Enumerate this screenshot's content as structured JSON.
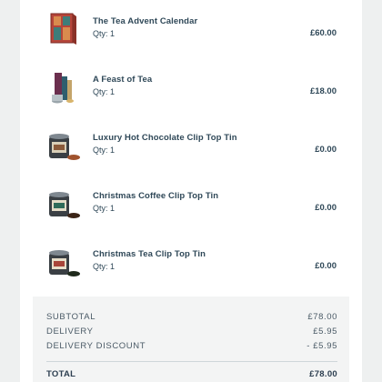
{
  "items": [
    {
      "name": "The Tea Advent Calendar",
      "qty": "Qty: 1",
      "price": "£60.00",
      "icon": "advent-calendar-icon"
    },
    {
      "name": "A Feast of Tea",
      "qty": "Qty: 1",
      "price": "£18.00",
      "icon": "tea-gift-set-icon"
    },
    {
      "name": "Luxury Hot Chocolate Clip Top Tin",
      "qty": "Qty: 1",
      "price": "£0.00",
      "icon": "hot-chocolate-tin-icon"
    },
    {
      "name": "Christmas Coffee Clip Top Tin",
      "qty": "Qty: 1",
      "price": "£0.00",
      "icon": "coffee-tin-icon"
    },
    {
      "name": "Christmas Tea Clip Top Tin",
      "qty": "Qty: 1",
      "price": "£0.00",
      "icon": "tea-tin-icon"
    }
  ],
  "summary": {
    "subtotal_label": "SUBTOTAL",
    "subtotal_value": "£78.00",
    "delivery_label": "DELIVERY",
    "delivery_value": "£5.95",
    "discount_label": "DELIVERY DISCOUNT",
    "discount_value": "- £5.95",
    "total_label": "TOTAL",
    "total_value": "£78.00"
  },
  "colors": {
    "page_bg": "#eef0f0",
    "card_bg": "#ffffff",
    "summary_bg": "#f3f4f4",
    "text": "#2f4858"
  }
}
